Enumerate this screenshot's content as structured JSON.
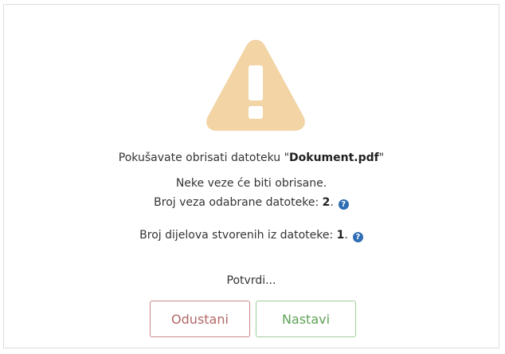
{
  "icons": {
    "warning": "warning-triangle-icon",
    "help": "question-circle-icon"
  },
  "colors": {
    "warning_fill": "#f2d4a5",
    "help_icon": "#2f6db5",
    "cancel_border": "#c98787",
    "cancel_text": "#b36767",
    "continue_border": "#9fcf98",
    "continue_text": "#5ea256"
  },
  "message": {
    "prefix": "Pokušavate obrisati datoteku \"",
    "filename": "Dokument.pdf",
    "suffix": "\""
  },
  "links_removed": "Neke veze će biti obrisane.",
  "link_count": {
    "label": "Broj veza odabrane datoteke: ",
    "value": "2",
    "period": ".",
    "help_glyph": "?"
  },
  "parts_count": {
    "label": "Broj dijelova stvorenih iz datoteke: ",
    "value": "1",
    "period": ".",
    "help_glyph": "?"
  },
  "confirm_prompt": "Potvrdi...",
  "buttons": {
    "cancel": "Odustani",
    "continue": "Nastavi"
  }
}
